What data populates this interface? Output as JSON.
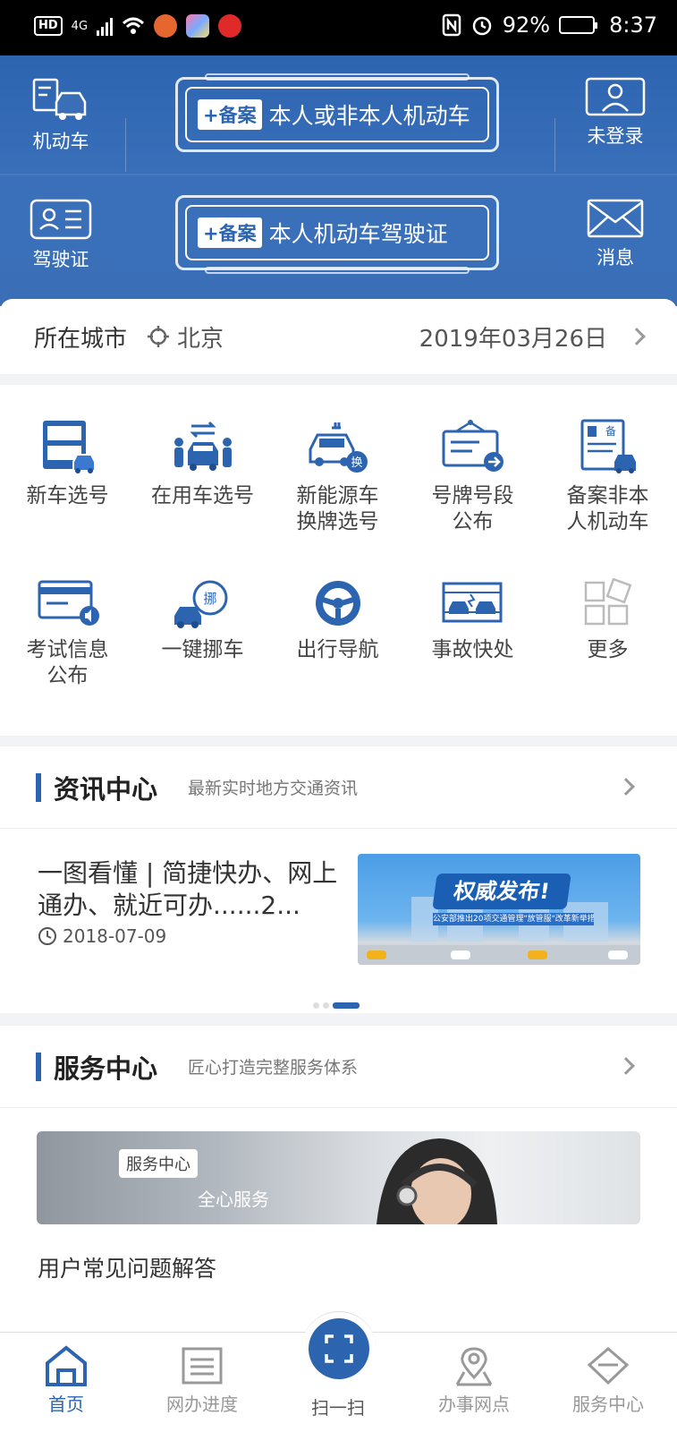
{
  "status_bar": {
    "hd": "HD",
    "network": "4G",
    "battery_text": "92%",
    "time": "8:37"
  },
  "header": {
    "vehicle_label": "机动车",
    "license_label": "驾驶证",
    "login_label": "未登录",
    "message_label": "消息",
    "plate1": {
      "tag": "+备案",
      "text": "本人或非本人机动车"
    },
    "plate2": {
      "tag": "+备案",
      "text": "本人机动车驾驶证"
    }
  },
  "city_row": {
    "label": "所在城市",
    "city": "北京",
    "date": "2019年03月26日"
  },
  "services": [
    {
      "line1": "新车选号",
      "line2": ""
    },
    {
      "line1": "在用车选号",
      "line2": ""
    },
    {
      "line1": "新能源车",
      "line2": "换牌选号"
    },
    {
      "line1": "号牌号段",
      "line2": "公布"
    },
    {
      "line1": "备案非本",
      "line2": "人机动车"
    },
    {
      "line1": "考试信息",
      "line2": "公布"
    },
    {
      "line1": "一键挪车",
      "line2": ""
    },
    {
      "line1": "出行导航",
      "line2": ""
    },
    {
      "line1": "事故快处",
      "line2": ""
    },
    {
      "line1": "更多",
      "line2": ""
    }
  ],
  "news_section": {
    "title": "资讯中心",
    "subtitle": "最新实时地方交通资讯",
    "item": {
      "title": "一图看懂 | 简捷快办、网上通办、就近可办......2...",
      "date": "2018-07-09",
      "image_banner": "权威发布!",
      "image_subtitle": "公安部推出20项交通管理\"放管服\"改革新举措"
    },
    "carousel_index": 3,
    "carousel_total": 3
  },
  "service_section": {
    "title": "服务中心",
    "subtitle": "匠心打造完整服务体系",
    "banner_tag": "服务中心",
    "banner_slogan": "全心服务",
    "faq": "用户常见问题解答"
  },
  "tabbar": {
    "home": "首页",
    "progress": "网办进度",
    "scan": "扫一扫",
    "outlets": "办事网点",
    "service": "服务中心"
  },
  "colors": {
    "primary": "#2d64b0",
    "header_bg": "#3a6fb8"
  }
}
